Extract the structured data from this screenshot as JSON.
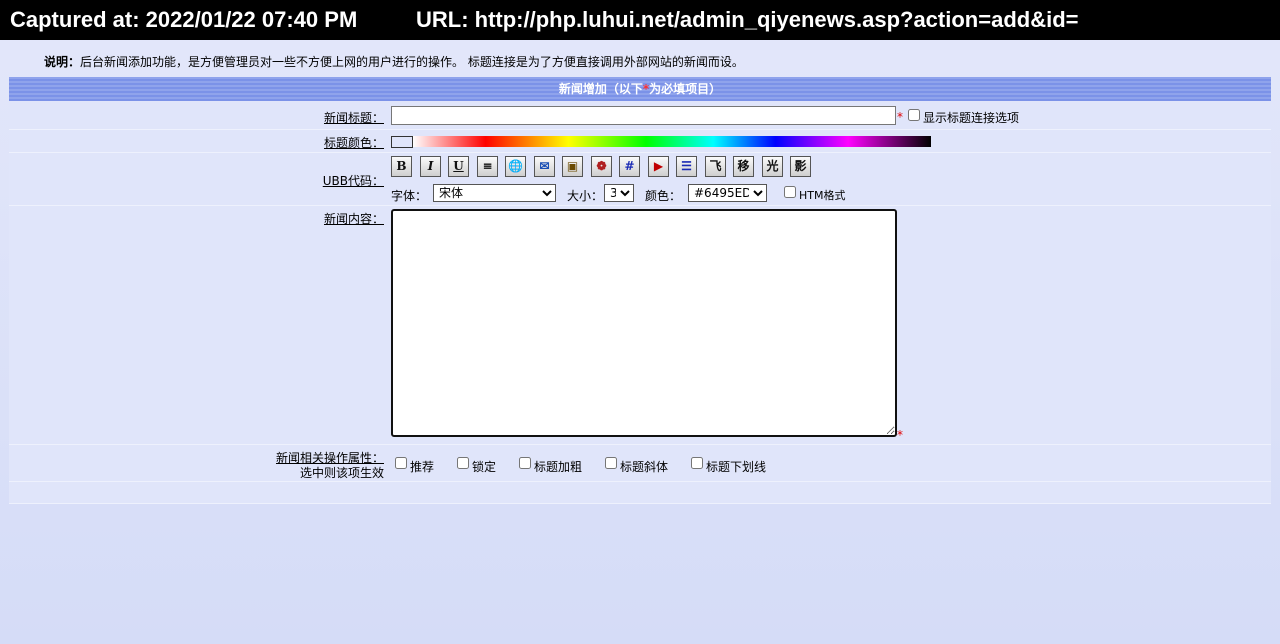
{
  "capture": {
    "captured": "Captured at: 2022/01/22 07:40 PM",
    "url": "URL: http://php.luhui.net/admin_qiyenews.asp?action=add&id="
  },
  "note": {
    "label": "说明：",
    "text": "后台新闻添加功能，是方便管理员对一些不方便上网的用户进行的操作。  标题连接是为了方便直接调用外部网站的新闻而设。"
  },
  "section": {
    "title_pre": "新闻增加（以下",
    "star": "*",
    "title_post": "为必填项目）"
  },
  "form": {
    "title_label": "新闻标题：",
    "title_value": "",
    "required_mark": "*",
    "show_link_label": "显示标题连接选项",
    "color_label": "标题颜色：",
    "ubb_label": "UBB代码：",
    "ubb_buttons": [
      "B",
      "I",
      "U",
      "≡",
      "🌐",
      "✉",
      "▣",
      "❁",
      "#",
      "▶",
      "☰",
      "飞",
      "移",
      "光",
      "影"
    ],
    "font_label": "字体：",
    "font_value": "宋体",
    "size_label": "大小：",
    "size_value": "3",
    "fontcolor_label": "颜色：",
    "fontcolor_value": "#6495ED",
    "html_label": "HTM格式",
    "content_label": "新闻内容：",
    "content_value": "",
    "attr_label_1": "新闻相关操作属性：",
    "attr_label_2": "选中则该项生效",
    "attrs": [
      "推荐",
      "锁定",
      "标题加粗",
      "标题斜体",
      "标题下划线"
    ]
  }
}
